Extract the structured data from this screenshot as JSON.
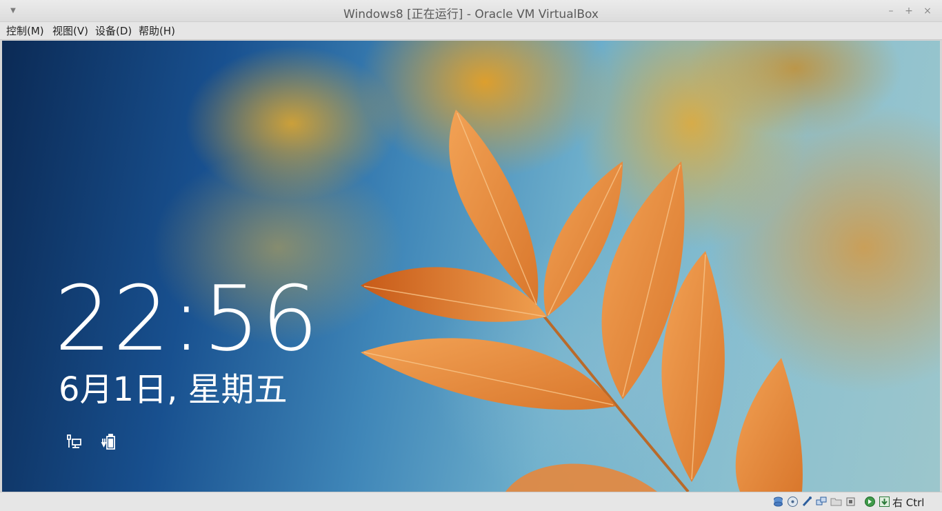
{
  "window": {
    "title": "Windows8 [正在运行] - Oracle VM VirtualBox",
    "menu_icon": "chevron-down-icon",
    "min_label": "–",
    "max_label": "+",
    "close_label": "×"
  },
  "menu": {
    "items": [
      {
        "label": "控制(M)"
      },
      {
        "label": "视图(V)"
      },
      {
        "label": "设备(D)"
      },
      {
        "label": "帮助(H)"
      }
    ]
  },
  "lockscreen": {
    "time": "22:56",
    "date": "6月1日, 星期五",
    "icons": [
      "network-icon",
      "battery-icon"
    ]
  },
  "statusbar": {
    "icons": [
      "hard-disk-icon",
      "optical-drive-icon",
      "usb-icon",
      "network-adapters-icon",
      "shared-folders-icon",
      "cpu-icon",
      "mouse-integration-icon",
      "keyboard-capture-icon"
    ],
    "host_key": "右 Ctrl"
  },
  "colors": {
    "leaf": "#e88a3a",
    "leaf_dark": "#c9631f",
    "bg_left": "#0b2a55",
    "bg_right": "#9cc6cc"
  }
}
